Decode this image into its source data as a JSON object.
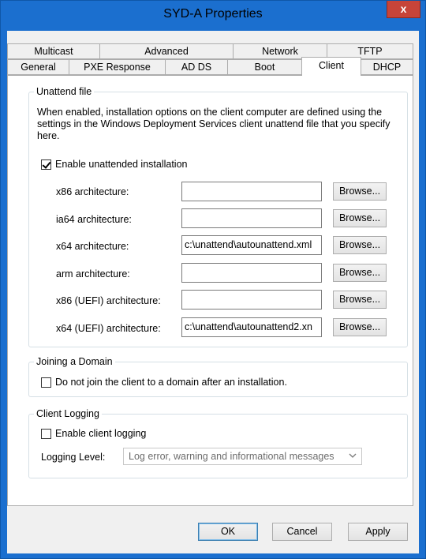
{
  "window": {
    "title": "SYD-A Properties",
    "close": "x"
  },
  "tabs": {
    "back": [
      "Multicast",
      "Advanced",
      "Network",
      "TFTP"
    ],
    "front": [
      "General",
      "PXE Response",
      "AD DS",
      "Boot",
      "Client",
      "DHCP"
    ],
    "active": "Client"
  },
  "unattend": {
    "legend": "Unattend file",
    "description": "When enabled, installation options on the client computer are defined using the settings in the Windows Deployment Services client unattend file that you specify here.",
    "enable_label": "Enable unattended installation",
    "enable_checked": true,
    "rows": [
      {
        "label": "x86 architecture:",
        "value": "",
        "button": "Browse..."
      },
      {
        "label": "ia64 architecture:",
        "value": "",
        "button": "Browse..."
      },
      {
        "label": "x64 architecture:",
        "value": "c:\\unattend\\autounattend.xml",
        "button": "Browse..."
      },
      {
        "label": "arm architecture:",
        "value": "",
        "button": "Browse..."
      },
      {
        "label": "x86 (UEFI) architecture:",
        "value": "",
        "button": "Browse..."
      },
      {
        "label": "x64 (UEFI) architecture:",
        "value": "c:\\unattend\\autounattend2.xn",
        "button": "Browse..."
      }
    ]
  },
  "domain": {
    "legend": "Joining a Domain",
    "checkbox_label": "Do not join the client to a domain after an installation.",
    "checked": false
  },
  "logging": {
    "legend": "Client Logging",
    "checkbox_label": "Enable client logging",
    "checked": false,
    "level_label": "Logging Level:",
    "level_value": "Log error, warning and informational messages"
  },
  "footer": {
    "ok": "OK",
    "cancel": "Cancel",
    "apply": "Apply"
  }
}
